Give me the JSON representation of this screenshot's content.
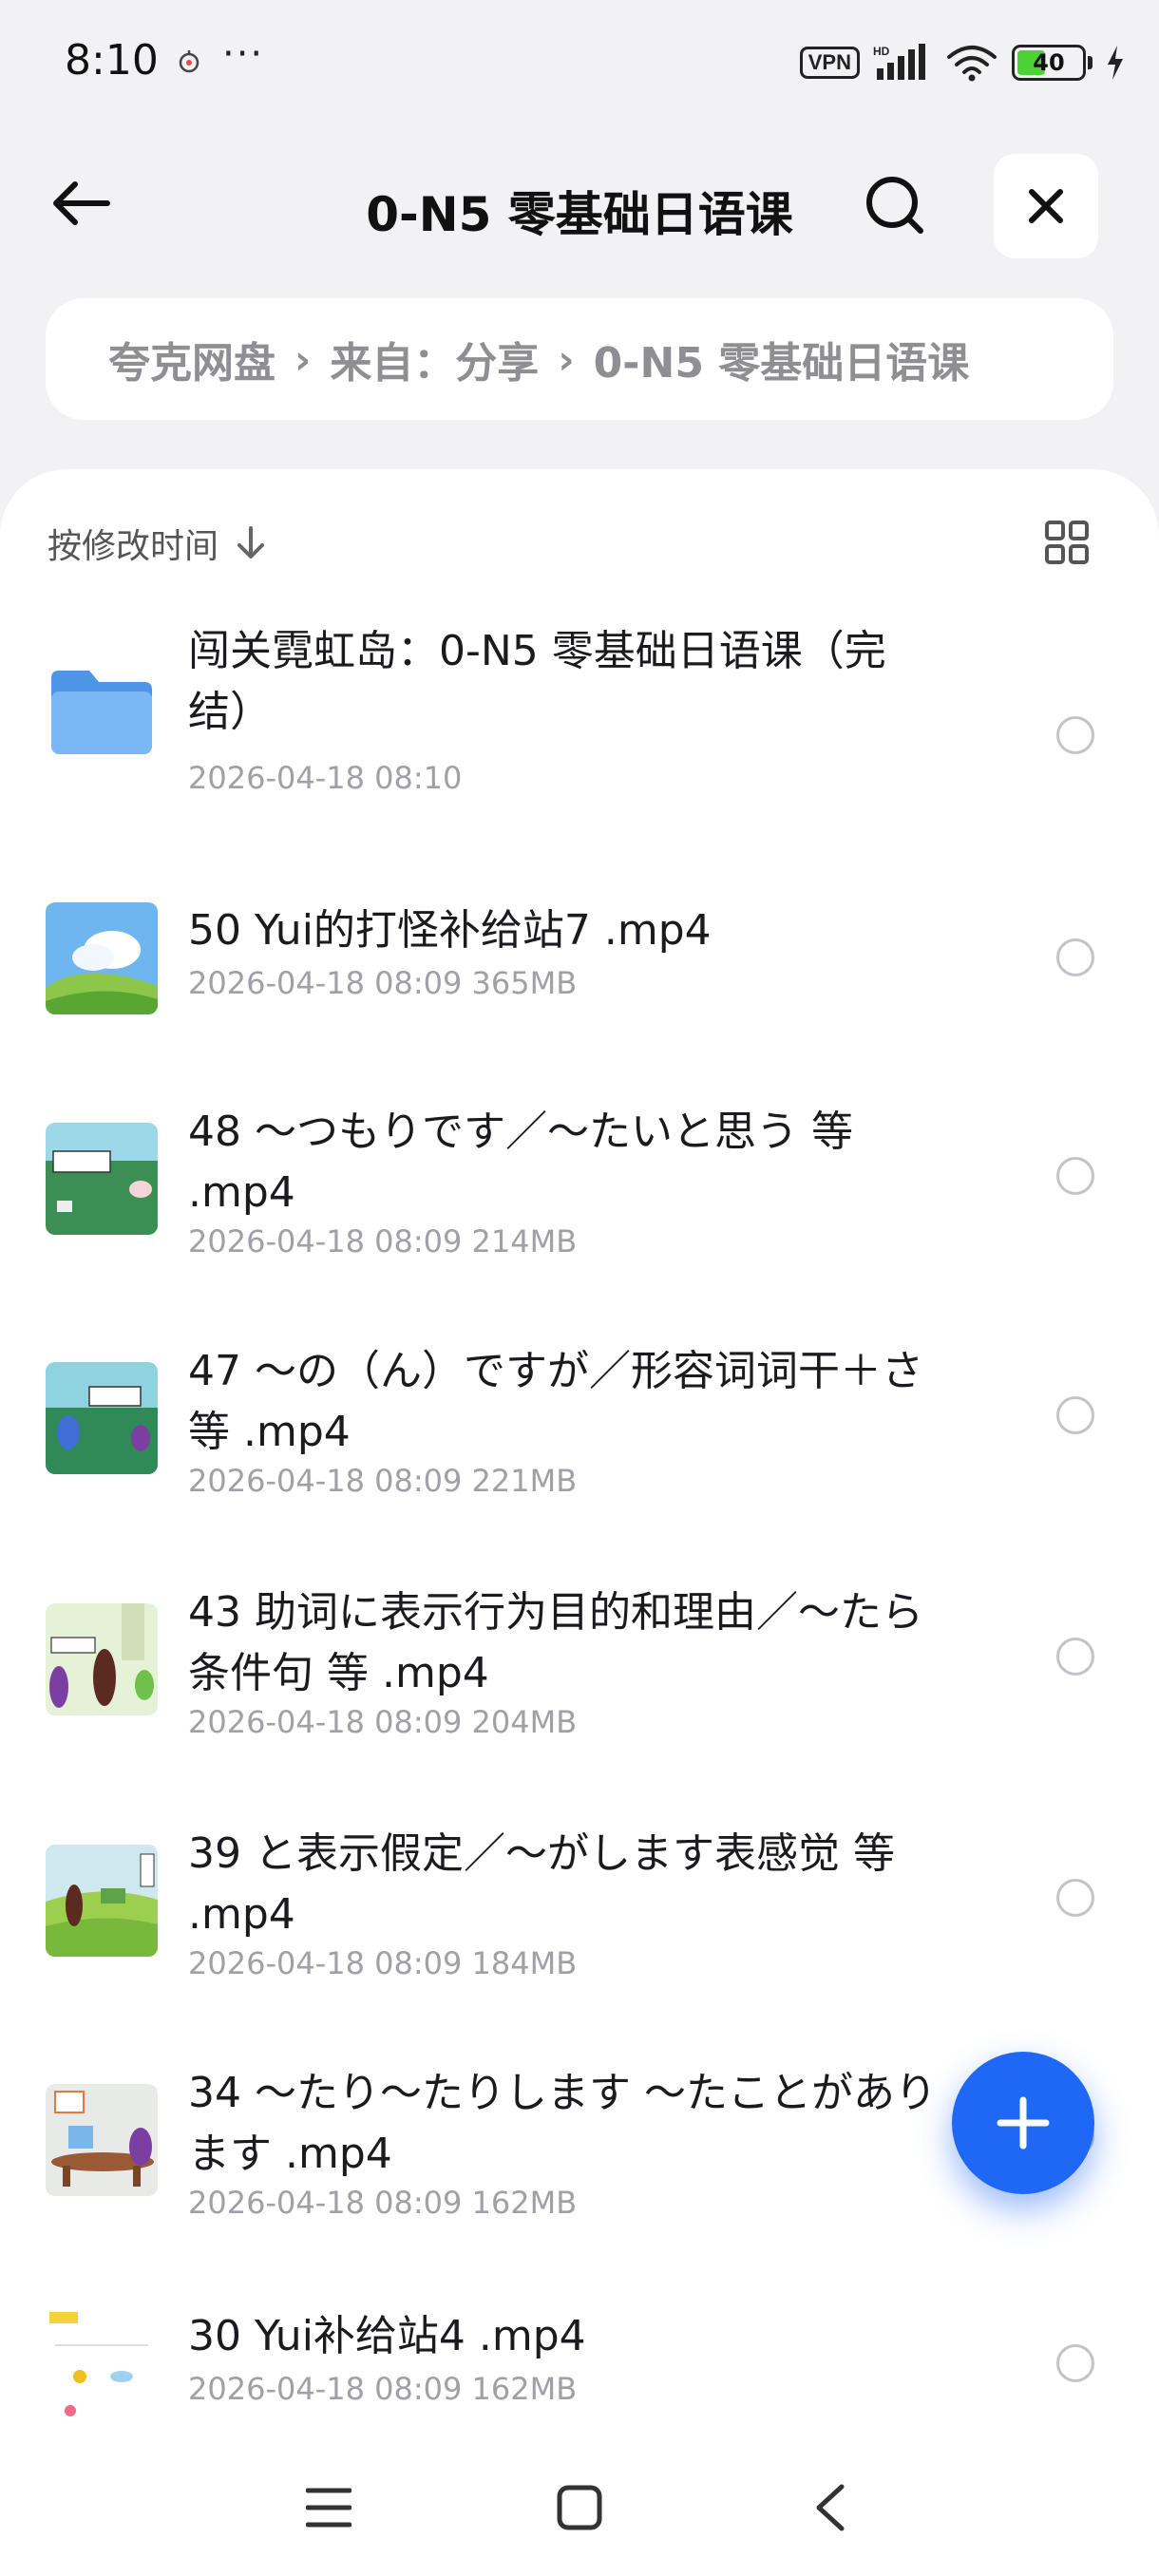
{
  "status_bar": {
    "time": "8:10",
    "dots": "···",
    "vpn": "VPN",
    "hd": "HD",
    "battery": "40"
  },
  "header": {
    "title": "0-N5 零基础日语课",
    "back_icon": "arrow-left-icon",
    "search_icon": "search-icon",
    "close_icon": "close-icon"
  },
  "breadcrumb": {
    "items": [
      "夸克网盘",
      "来自：分享",
      "0-N5 零基础日语课"
    ],
    "separator": "›"
  },
  "toolbar": {
    "sort_label": "按修改时间",
    "sort_icon": "arrow-down-icon",
    "view_icon": "grid-view-icon"
  },
  "files": [
    {
      "name": "闯关霓虹岛：0-N5 零基础日语课（完结）",
      "meta": "2026-04-18 08:10",
      "type": "folder"
    },
    {
      "name": "50 Yui的打怪补给站7 .mp4",
      "meta": "2026-04-18 08:09  365MB",
      "type": "video"
    },
    {
      "name": "48 ～つもりです／～たいと思う 等 .mp4",
      "meta": "2026-04-18 08:09  214MB",
      "type": "video"
    },
    {
      "name": "47 ～の（ん）ですが／形容词词干＋さ 等 .mp4",
      "meta": "2026-04-18 08:09  221MB",
      "type": "video"
    },
    {
      "name": "43 助词に表示行为目的和理由／～たら条件句 等 .mp4",
      "meta": "2026-04-18 08:09  204MB",
      "type": "video"
    },
    {
      "name": "39 と表示假定／～がします表感觉  等 .mp4",
      "meta": "2026-04-18 08:09  184MB",
      "type": "video"
    },
    {
      "name": "34 ～たり～たりします ～たことがあります .mp4",
      "meta": "2026-04-18 08:09  162MB",
      "type": "video"
    },
    {
      "name": "30 Yui补给站4 .mp4",
      "meta": "2026-04-18 08:09  162MB",
      "type": "video"
    }
  ],
  "fab": {
    "icon": "plus-icon"
  },
  "nav": {
    "menu_icon": "menu-icon",
    "home_icon": "home-square-icon",
    "back_icon": "back-chevron-icon"
  },
  "colors": {
    "accent": "#1f67f5",
    "folder": "#6aaaf0"
  }
}
